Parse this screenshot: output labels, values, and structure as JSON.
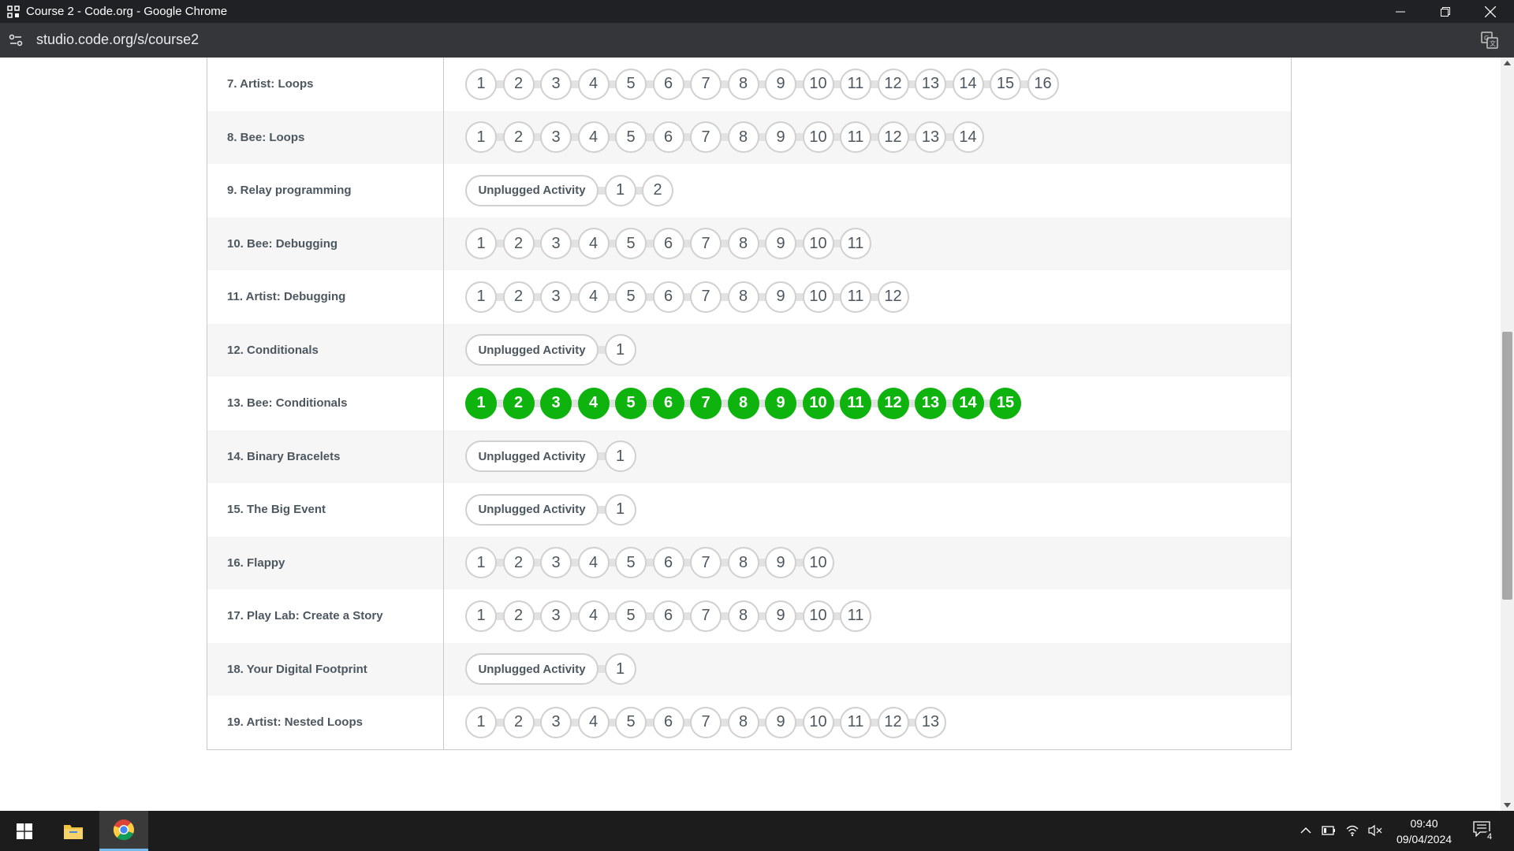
{
  "window": {
    "title": "Course 2 - Code.org - Google Chrome"
  },
  "browser": {
    "url": "studio.code.org/s/course2"
  },
  "lessons": [
    {
      "name": "7. Artist: Loops",
      "unplugged": null,
      "levels": [
        "1",
        "2",
        "3",
        "4",
        "5",
        "6",
        "7",
        "8",
        "9",
        "10",
        "11",
        "12",
        "13",
        "14",
        "15",
        "16"
      ],
      "completed": false
    },
    {
      "name": "8. Bee: Loops",
      "unplugged": null,
      "levels": [
        "1",
        "2",
        "3",
        "4",
        "5",
        "6",
        "7",
        "8",
        "9",
        "10",
        "11",
        "12",
        "13",
        "14"
      ],
      "completed": false
    },
    {
      "name": "9. Relay programming",
      "unplugged": "Unplugged Activity",
      "levels": [
        "1",
        "2"
      ],
      "completed": false
    },
    {
      "name": "10. Bee: Debugging",
      "unplugged": null,
      "levels": [
        "1",
        "2",
        "3",
        "4",
        "5",
        "6",
        "7",
        "8",
        "9",
        "10",
        "11"
      ],
      "completed": false
    },
    {
      "name": "11. Artist: Debugging",
      "unplugged": null,
      "levels": [
        "1",
        "2",
        "3",
        "4",
        "5",
        "6",
        "7",
        "8",
        "9",
        "10",
        "11",
        "12"
      ],
      "completed": false
    },
    {
      "name": "12. Conditionals",
      "unplugged": "Unplugged Activity",
      "levels": [
        "1"
      ],
      "completed": false
    },
    {
      "name": "13. Bee: Conditionals",
      "unplugged": null,
      "levels": [
        "1",
        "2",
        "3",
        "4",
        "5",
        "6",
        "7",
        "8",
        "9",
        "10",
        "11",
        "12",
        "13",
        "14",
        "15"
      ],
      "completed": true
    },
    {
      "name": "14. Binary Bracelets",
      "unplugged": "Unplugged Activity",
      "levels": [
        "1"
      ],
      "completed": false
    },
    {
      "name": "15. The Big Event",
      "unplugged": "Unplugged Activity",
      "levels": [
        "1"
      ],
      "completed": false
    },
    {
      "name": "16. Flappy",
      "unplugged": null,
      "levels": [
        "1",
        "2",
        "3",
        "4",
        "5",
        "6",
        "7",
        "8",
        "9",
        "10"
      ],
      "completed": false
    },
    {
      "name": "17. Play Lab: Create a Story",
      "unplugged": null,
      "levels": [
        "1",
        "2",
        "3",
        "4",
        "5",
        "6",
        "7",
        "8",
        "9",
        "10",
        "11"
      ],
      "completed": false
    },
    {
      "name": "18. Your Digital Footprint",
      "unplugged": "Unplugged Activity",
      "levels": [
        "1"
      ],
      "completed": false
    },
    {
      "name": "19. Artist: Nested Loops",
      "unplugged": null,
      "levels": [
        "1",
        "2",
        "3",
        "4",
        "5",
        "6",
        "7",
        "8",
        "9",
        "10",
        "11",
        "12",
        "13"
      ],
      "completed": false
    }
  ],
  "colors": {
    "completed": "#0eb30e",
    "bubble_border": "#d0d0d0",
    "text": "#4d575f"
  },
  "taskbar": {
    "time": "09:40",
    "date": "09/04/2024",
    "notification_count": "4",
    "icons": [
      "windows-start-icon",
      "file-explorer-icon",
      "chrome-icon"
    ],
    "tray_icons": [
      "chevron-up-icon",
      "battery-icon",
      "wifi-icon",
      "speaker-muted-icon",
      "notification-icon"
    ]
  }
}
